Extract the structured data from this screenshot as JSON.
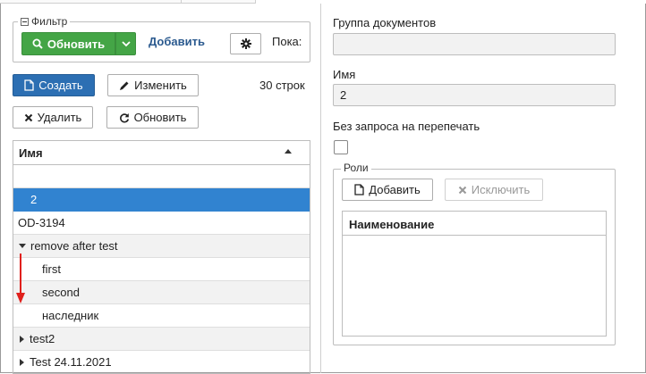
{
  "filter": {
    "legend": "Фильтр",
    "refresh_label": "Обновить",
    "add_link": "Добавить",
    "show_label": "Пока:"
  },
  "toolbar": {
    "create_label": "Создать",
    "edit_label": "Изменить",
    "delete_label": "Удалить",
    "refresh_label": "Обновить",
    "row_count": "30 строк"
  },
  "grid": {
    "column": "Имя",
    "rows": [
      {
        "label": "2",
        "selected": true
      },
      {
        "label": "OD-3194"
      },
      {
        "label": "remove after test",
        "expanded": true
      },
      {
        "label": "first"
      },
      {
        "label": "second"
      },
      {
        "label": "наследник"
      },
      {
        "label": "test2",
        "collapsed": true
      },
      {
        "label": "Test 24.11.2021",
        "collapsed": true
      }
    ]
  },
  "form": {
    "doc_group_label": "Группа документов",
    "doc_group_value": "",
    "name_label": "Имя",
    "name_value": "2",
    "no_request_label": "Без запроса на перепечать",
    "no_request_checked": false
  },
  "roles": {
    "legend": "Роли",
    "add_label": "Добавить",
    "exclude_label": "Исключить",
    "column": "Наименование"
  },
  "colors": {
    "green": "#44a546",
    "blue": "#2c6fb3",
    "selected_row": "#3183d0",
    "arrow": "#e0201c"
  }
}
